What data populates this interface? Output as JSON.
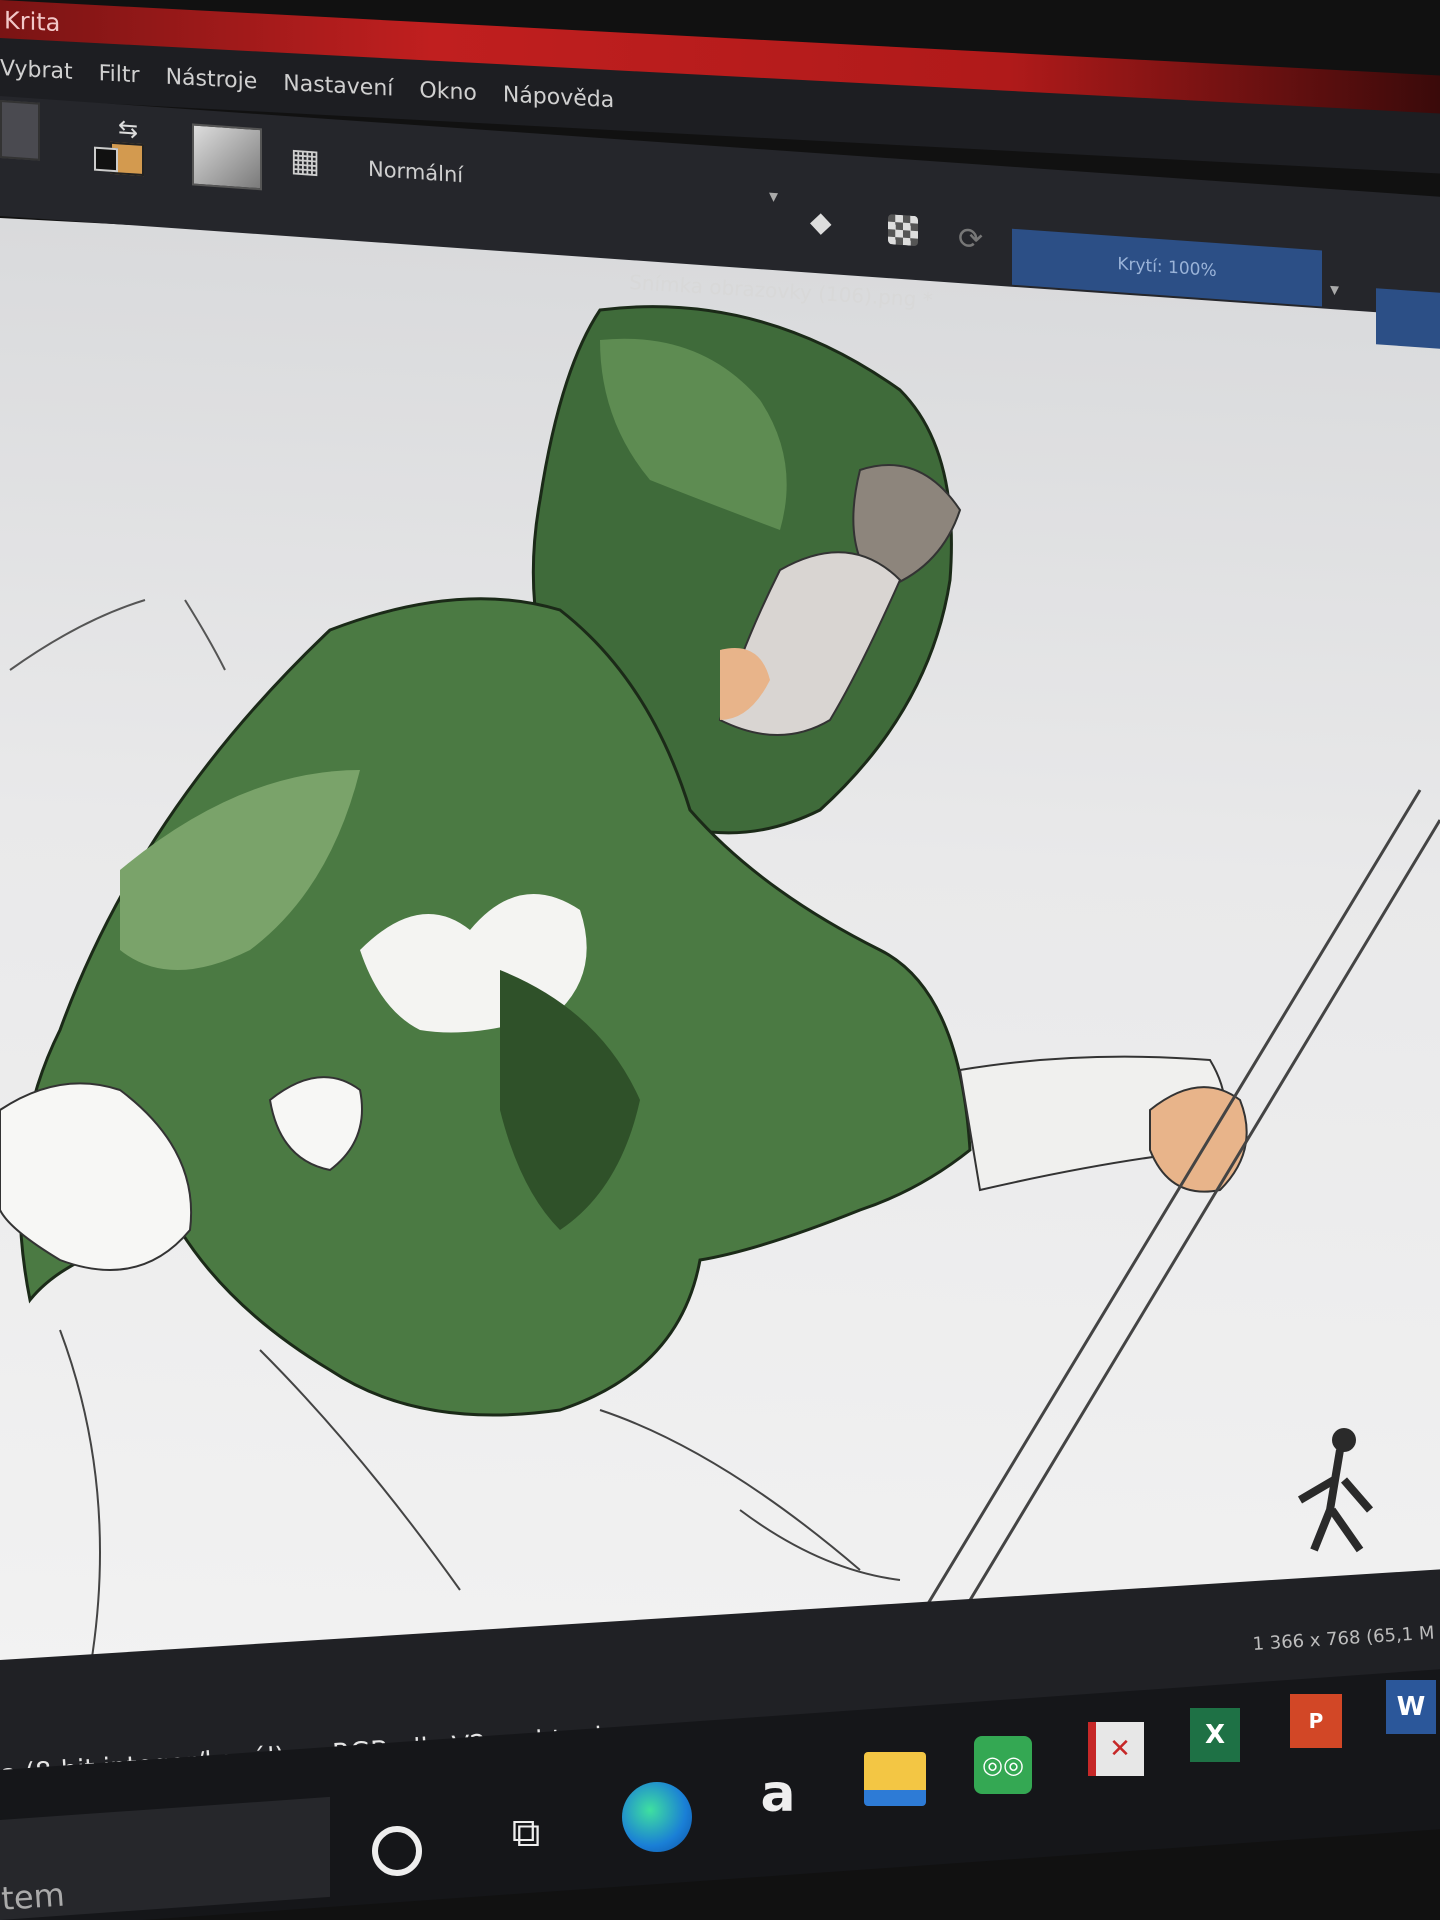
{
  "app": {
    "title": "Krita"
  },
  "menu": {
    "items": [
      {
        "label": "Vybrat",
        "name": "menu-vybrat"
      },
      {
        "label": "Filtr",
        "name": "menu-filtr"
      },
      {
        "label": "Nástroje",
        "name": "menu-nastroje"
      },
      {
        "label": "Nastavení",
        "name": "menu-nastaveni"
      },
      {
        "label": "Okno",
        "name": "menu-okno"
      },
      {
        "label": "Nápověda",
        "name": "menu-napoveda"
      }
    ]
  },
  "toolbar": {
    "blend_mode": "Normální",
    "opacity_label": "Krytí: 100%",
    "colors": {
      "foreground": "#111111",
      "background": "#d39a4f"
    }
  },
  "document": {
    "tab_title": "Snímka obrazovky (106).png *"
  },
  "status": {
    "color_model": "a (8-bit integer/kanál)",
    "profile": "sRGB-elle-V2-srgbtrc.icc",
    "dimensions": "1 366 x 768 (65,1 M"
  },
  "taskbar": {
    "search_text": "tem",
    "icons": [
      "cortana-icon",
      "task-view-icon",
      "edge-icon",
      "amazon-icon",
      "file-explorer-icon",
      "tripadvisor-icon",
      "acrobat-icon",
      "excel-icon",
      "powerpoint-icon",
      "word-icon"
    ]
  },
  "colors": {
    "hood_green": "#3f6b3a",
    "hood_dark": "#24401f",
    "sleeve_light": "#7aa36a",
    "skin": "#e8b48a",
    "hair": "#8d857c",
    "titlebar_red": "#c01f1f",
    "opacity_blue": "#2c4f86"
  }
}
